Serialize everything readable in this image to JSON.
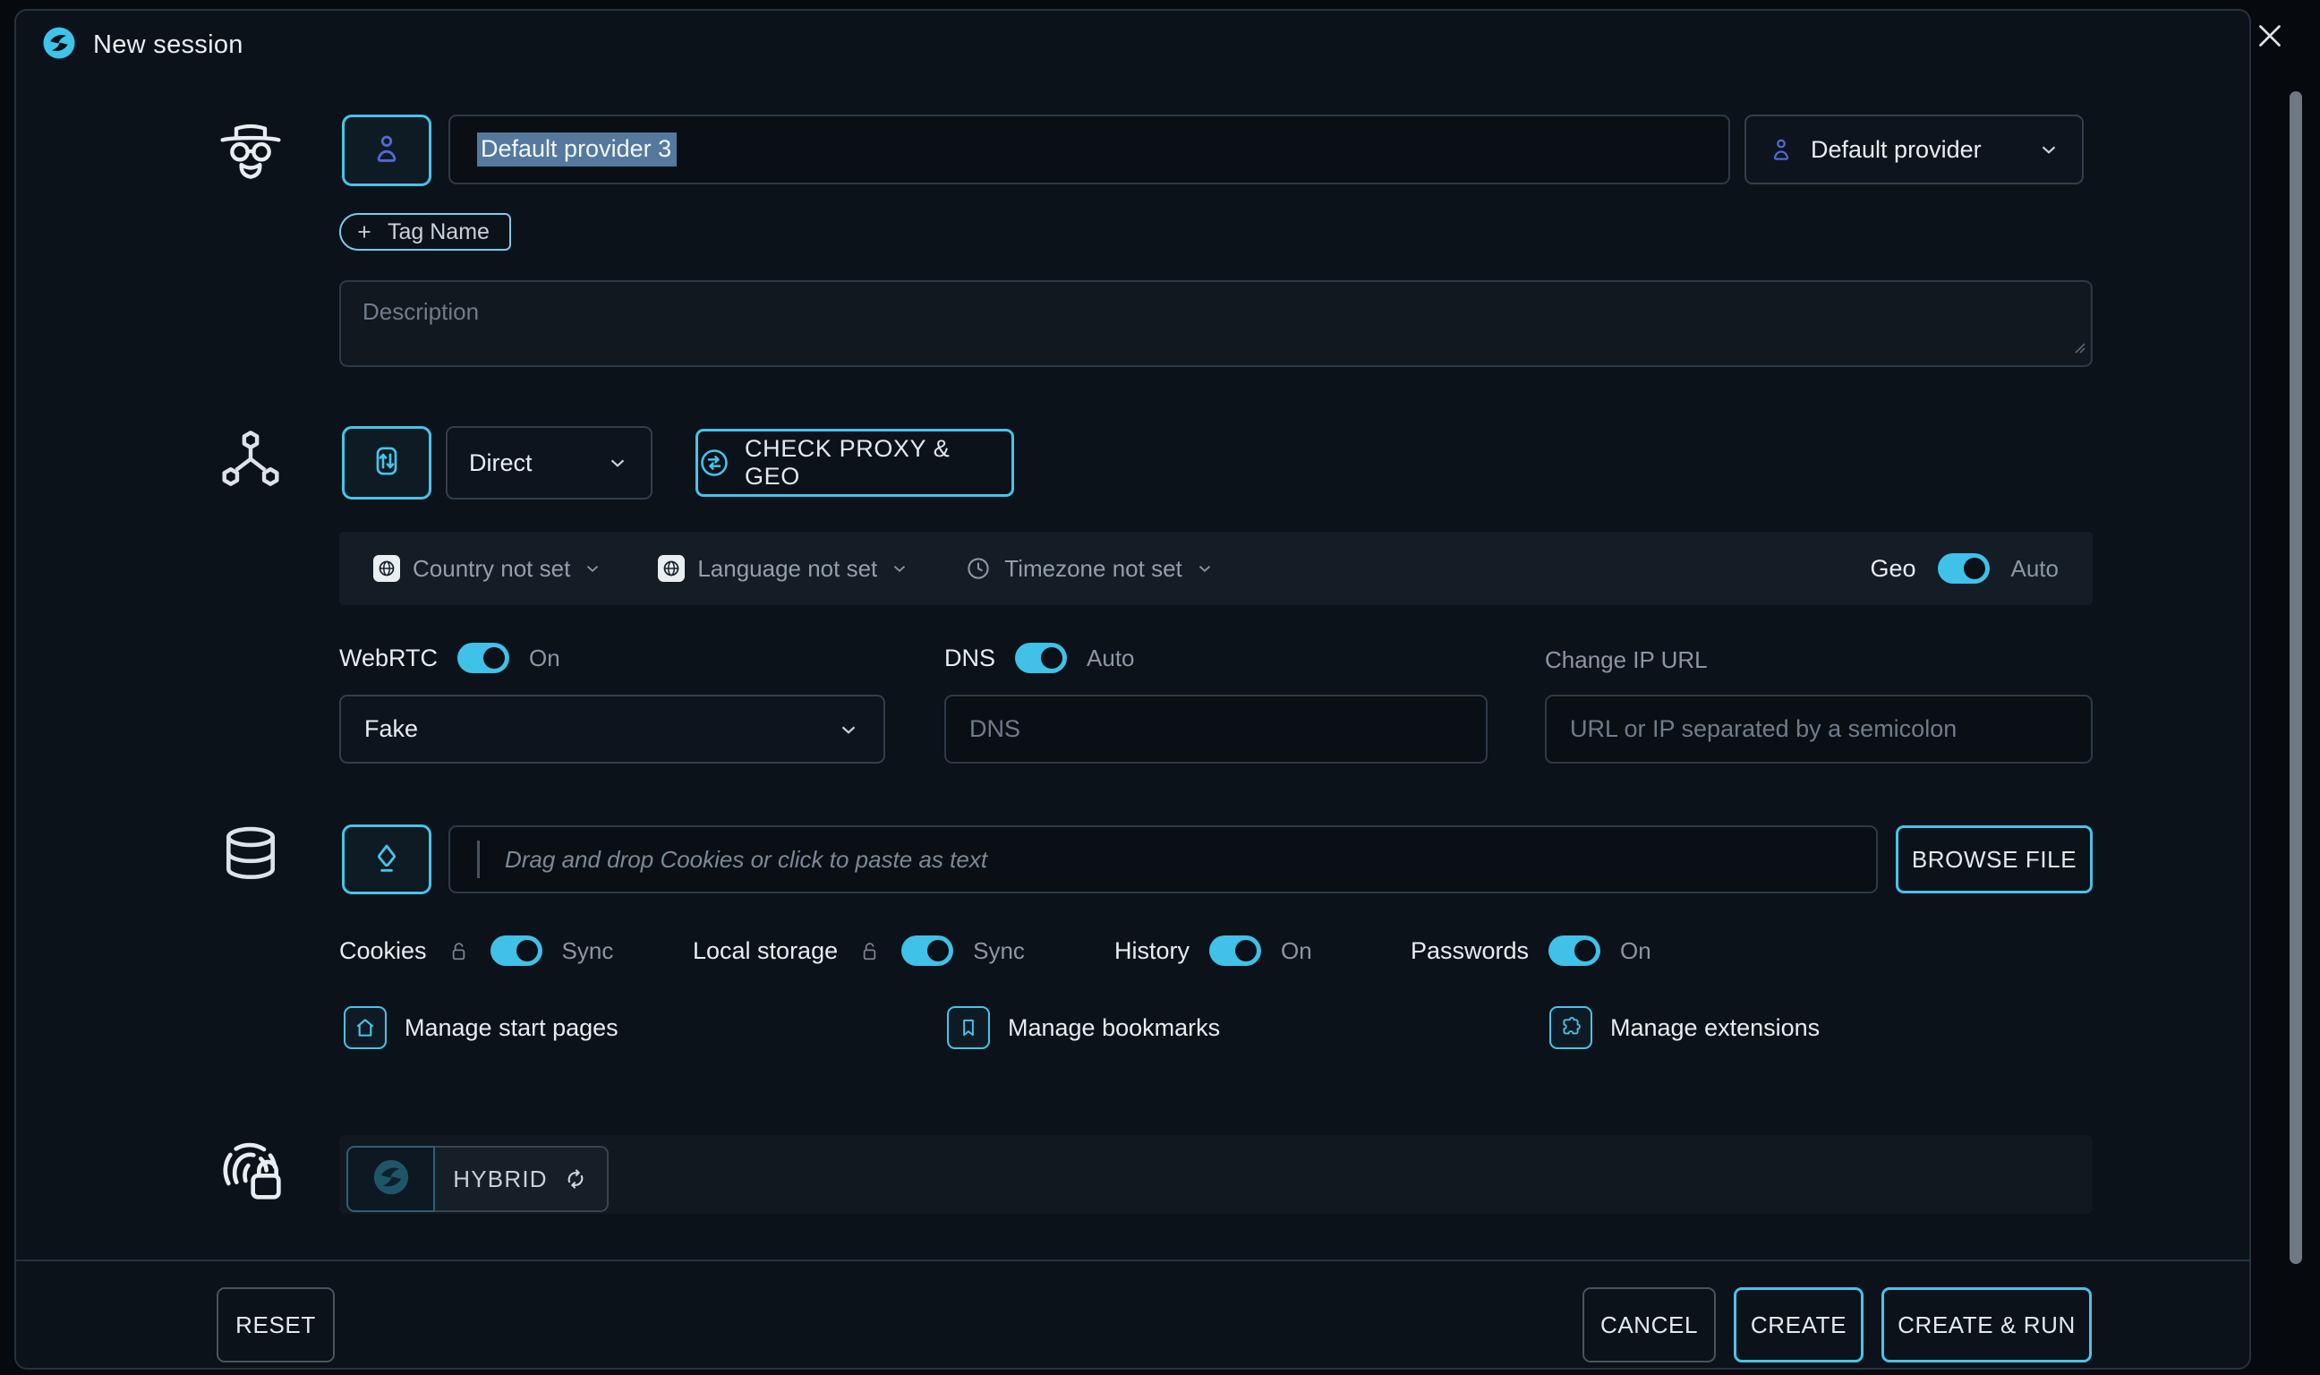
{
  "header": {
    "title": "New session"
  },
  "profile": {
    "name_value": "Default provider 3",
    "provider_label": "Default provider",
    "tag_button": "Tag Name",
    "description_placeholder": "Description"
  },
  "proxy": {
    "connection_value": "Direct",
    "check_button": "CHECK PROXY & GEO",
    "country": "Country not set",
    "language": "Language not set",
    "timezone": "Timezone not set",
    "geo_label": "Geo",
    "geo_state": "Auto",
    "webrtc_label": "WebRTC",
    "webrtc_state": "On",
    "webrtc_mode": "Fake",
    "dns_label": "DNS",
    "dns_state": "Auto",
    "dns_placeholder": "DNS",
    "change_ip_label": "Change IP URL",
    "change_ip_placeholder": "URL or IP separated by a semicolon"
  },
  "storage": {
    "cookies_placeholder": "Drag and drop Cookies or click to paste as text",
    "browse_button": "BROWSE FILE",
    "toggles": [
      {
        "label": "Cookies",
        "state": "Sync"
      },
      {
        "label": "Local storage",
        "state": "Sync"
      },
      {
        "label": "History",
        "state": "On"
      },
      {
        "label": "Passwords",
        "state": "On"
      }
    ],
    "manage": [
      {
        "label": "Manage start pages"
      },
      {
        "label": "Manage bookmarks"
      },
      {
        "label": "Manage extensions"
      }
    ]
  },
  "fingerprint": {
    "mode_label": "HYBRID"
  },
  "footer": {
    "reset": "RESET",
    "cancel": "CANCEL",
    "create": "CREATE",
    "create_run": "CREATE & RUN"
  },
  "colors": {
    "accent": "#48c3ea",
    "toggle_on": "#3fc1e8",
    "selection": "#54799c"
  }
}
